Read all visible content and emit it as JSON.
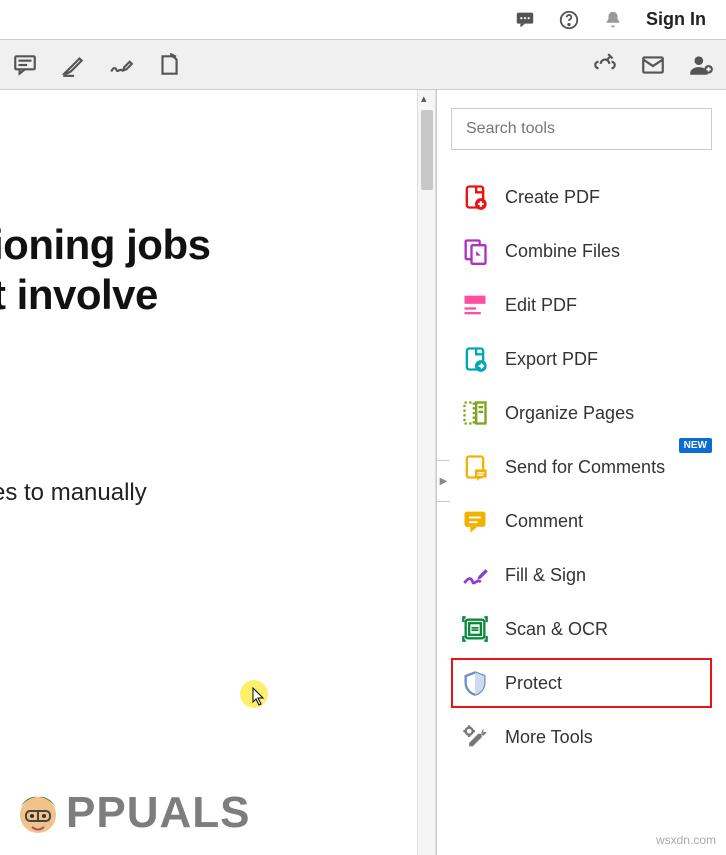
{
  "topbar": {
    "signin_label": "Sign In"
  },
  "search": {
    "placeholder": "Search tools"
  },
  "tools": [
    {
      "id": "create-pdf",
      "label": "Create PDF",
      "icon": "create-pdf-icon",
      "badge": null
    },
    {
      "id": "combine-files",
      "label": "Combine Files",
      "icon": "combine-files-icon",
      "badge": null
    },
    {
      "id": "edit-pdf",
      "label": "Edit PDF",
      "icon": "edit-pdf-icon",
      "badge": null
    },
    {
      "id": "export-pdf",
      "label": "Export PDF",
      "icon": "export-pdf-icon",
      "badge": null
    },
    {
      "id": "organize",
      "label": "Organize Pages",
      "icon": "organize-icon",
      "badge": null
    },
    {
      "id": "send-comments",
      "label": "Send for Comments",
      "icon": "send-comments-icon",
      "badge": "NEW"
    },
    {
      "id": "comment",
      "label": "Comment",
      "icon": "comment-icon",
      "badge": null
    },
    {
      "id": "fill-sign",
      "label": "Fill & Sign",
      "icon": "fill-sign-icon",
      "badge": null
    },
    {
      "id": "scan-ocr",
      "label": "Scan & OCR",
      "icon": "scan-ocr-icon",
      "badge": null
    },
    {
      "id": "protect",
      "label": "Protect",
      "icon": "protect-icon",
      "badge": null,
      "highlighted": true
    },
    {
      "id": "more-tools",
      "label": "More Tools",
      "icon": "more-tools-icon",
      "badge": null
    }
  ],
  "document": {
    "title_line1": "ioning jobs",
    "title_line2": "t involve",
    "body_line": "es to manually"
  },
  "branding": {
    "logo_text": "PPUALS"
  },
  "watermark": "wsxdn.com"
}
